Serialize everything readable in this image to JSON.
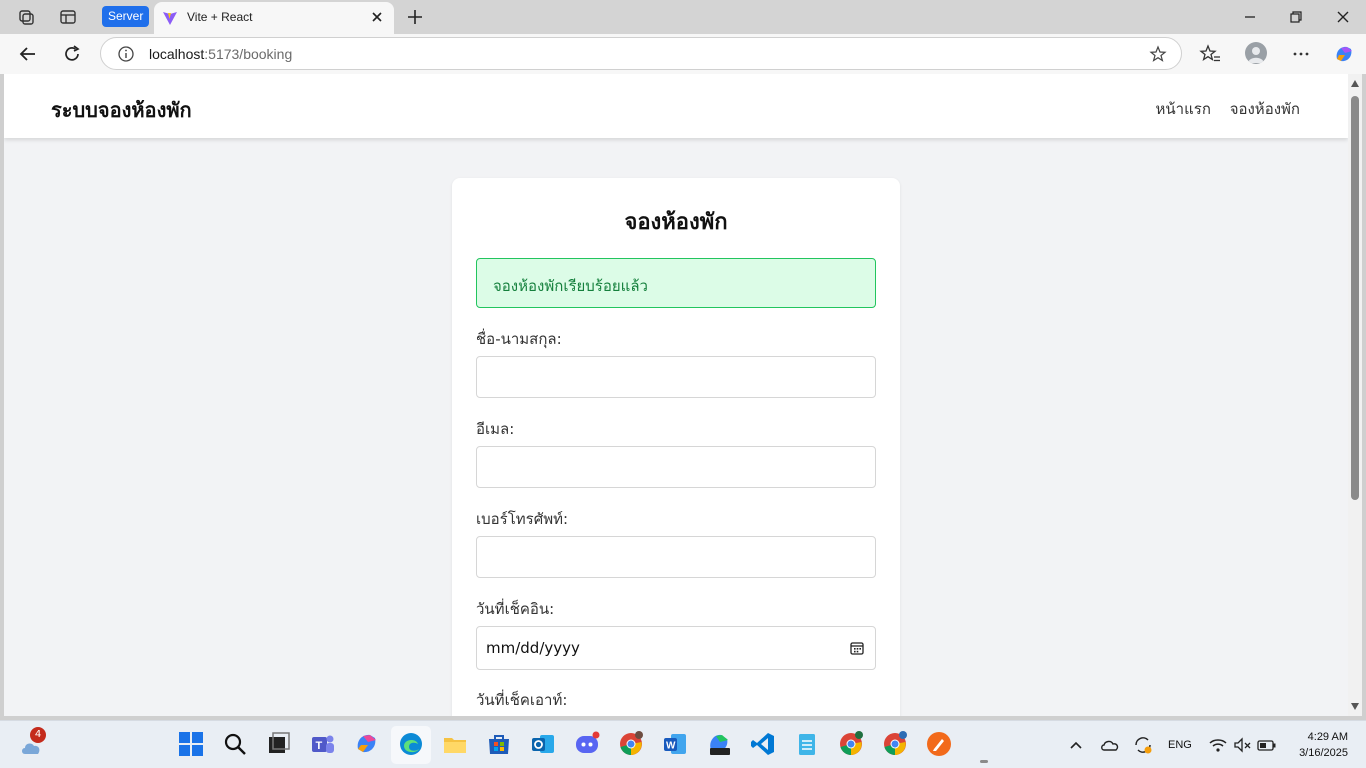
{
  "browser": {
    "tab_group_label": "Server",
    "tab_title": "Vite + React",
    "url_host": "localhost",
    "url_path": ":5173/booking"
  },
  "app": {
    "brand": "ระบบจองห้องพัก",
    "nav": {
      "home": "หน้าแรก",
      "booking": "จองห้องพัก"
    }
  },
  "form": {
    "title": "จองห้องพัก",
    "success_message": "จองห้องพักเรียบร้อยแล้ว",
    "fields": {
      "name_label": "ชื่อ-นามสกุล:",
      "email_label": "อีเมล:",
      "phone_label": "เบอร์โทรศัพท์:",
      "checkin_label": "วันที่เช็คอิน:",
      "checkin_placeholder": "mm/dd/yyyy",
      "checkout_label": "วันที่เช็คเอาท์:"
    }
  },
  "taskbar": {
    "weather_badge": "4",
    "language": "ENG",
    "time": "4:29 AM",
    "date": "3/16/2025"
  },
  "colors": {
    "accent": "#1f6feb",
    "success_bg": "#dcfce7",
    "success_border": "#22c55e",
    "success_text": "#15803d"
  }
}
